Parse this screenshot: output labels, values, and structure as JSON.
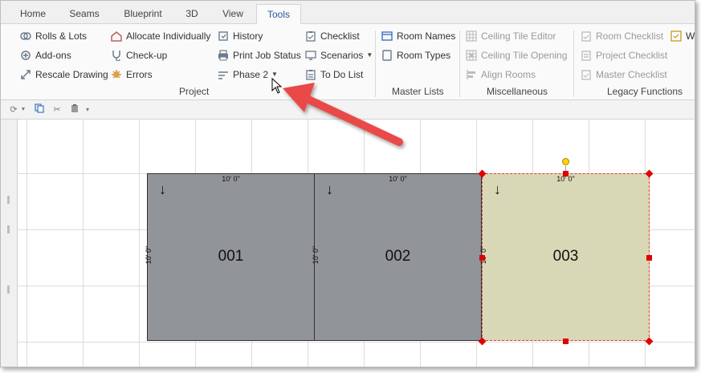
{
  "tabs": [
    {
      "label": "Home"
    },
    {
      "label": "Seams"
    },
    {
      "label": "Blueprint"
    },
    {
      "label": "3D"
    },
    {
      "label": "View"
    },
    {
      "label": "Tools",
      "active": true
    }
  ],
  "ribbon": {
    "project": {
      "label": "Project",
      "col1": [
        "Rolls & Lots",
        "Add-ons",
        "Rescale Drawing"
      ],
      "col2": [
        "Allocate Individually",
        "Check-up",
        "Errors"
      ],
      "col3": [
        "History",
        "Print Job Status",
        "Phase 2"
      ],
      "col4": [
        "Checklist",
        "Scenarios",
        "To Do List"
      ]
    },
    "master_lists": {
      "label": "Master Lists",
      "items": [
        "Room Names",
        "Room Types"
      ]
    },
    "miscellaneous": {
      "label": "Miscellaneous",
      "items": [
        "Ceiling Tile Editor",
        "Ceiling Tile Opening",
        "Align Rooms"
      ]
    },
    "legacy": {
      "label": "Legacy Functions",
      "items": [
        "Room Checklist",
        "Project Checklist",
        "Master Checklist"
      ],
      "overflow": "W"
    }
  },
  "rooms": [
    {
      "number": "001",
      "width_label": "10' 0\"",
      "height_label": "10' 0\""
    },
    {
      "number": "002",
      "width_label": "10' 0\"",
      "height_label": "10' 0\""
    },
    {
      "number": "003",
      "width_label": "10' 0\"",
      "height_label": "10' 0\""
    }
  ],
  "colors": {
    "room_fill": "#919498",
    "selected_fill": "#d9d8b6",
    "selection": "#e53935",
    "callout_arrow": "#ea4a4a"
  }
}
